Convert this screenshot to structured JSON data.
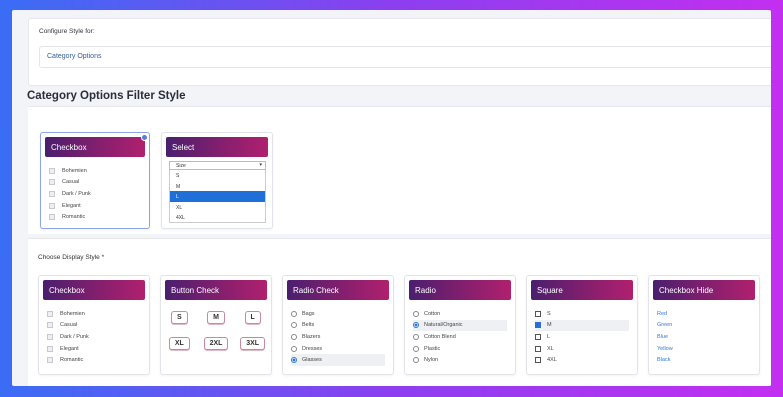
{
  "config": {
    "label": "Configure Style for:",
    "selected_value": "Category Options"
  },
  "heading": "Category Options Filter Style",
  "preview": {
    "checkbox_card": {
      "title": "Checkbox",
      "items": [
        "Bohemien",
        "Casual",
        "Dark / Punk",
        "Elegant",
        "Romantic"
      ]
    },
    "select_card": {
      "title": "Select",
      "field_value": "Size",
      "options": [
        "S",
        "M",
        "L",
        "XL",
        "4XL"
      ],
      "highlighted": "L"
    }
  },
  "display": {
    "label": "Choose Display Style *",
    "cards": {
      "checkbox": {
        "title": "Checkbox",
        "items": [
          "Bohemien",
          "Casual",
          "Dark / Punk",
          "Elegant",
          "Romantic"
        ]
      },
      "button_check": {
        "title": "Button Check",
        "items": [
          "S",
          "M",
          "L",
          "XL",
          "2XL",
          "3XL"
        ]
      },
      "radio_check": {
        "title": "Radio Check",
        "items": [
          "Bags",
          "Belts",
          "Blazers",
          "Dresses",
          "Glasses"
        ],
        "checked": "Glasses"
      },
      "radio": {
        "title": "Radio",
        "items": [
          "Cotton",
          "Natural/Organic",
          "Cotton Blend",
          "Plastic",
          "Nylon"
        ],
        "checked": "Natural/Organic"
      },
      "square": {
        "title": "Square",
        "items": [
          "S",
          "M",
          "L",
          "XL",
          "4XL"
        ],
        "checked": "M"
      },
      "checkbox_hide": {
        "title": "Checkbox Hide",
        "items": [
          "Red",
          "Green",
          "Blue",
          "Yellow",
          "Black"
        ]
      }
    }
  },
  "colors": {
    "header_gradient_start": "#4a1f6e",
    "header_gradient_end": "#b0206e",
    "accent_blue": "#2b7bd6",
    "selected_border": "#8fa3e8"
  }
}
